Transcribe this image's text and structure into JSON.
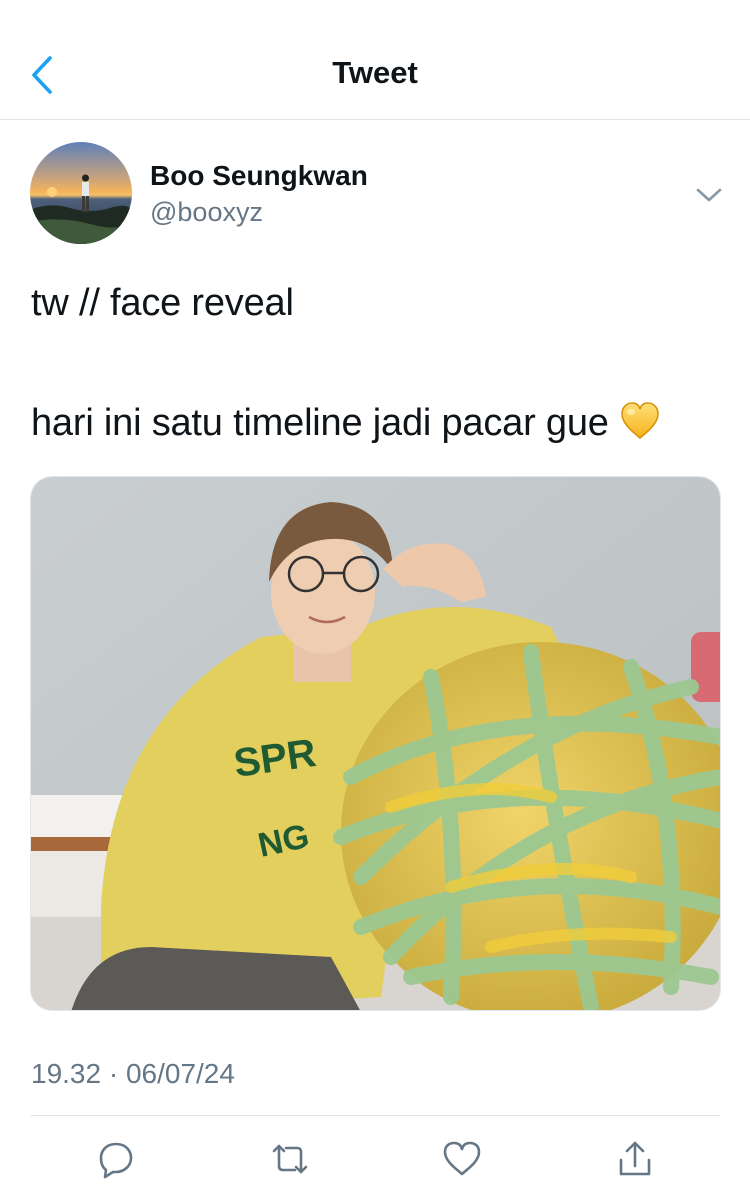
{
  "header": {
    "title": "Tweet",
    "back_icon": "chevron-left-icon"
  },
  "author": {
    "name": "Boo Seungkwan",
    "handle": "@booxyz"
  },
  "tweet": {
    "line1": "tw // face reveal",
    "line2": "hari ini satu timeline jadi pacar gue",
    "emoji": "yellow-heart-icon",
    "timestamp": "19.32 · 06/07/24"
  },
  "actions": [
    {
      "icon": "reply-icon"
    },
    {
      "icon": "retweet-icon"
    },
    {
      "icon": "like-icon"
    },
    {
      "icon": "share-icon"
    }
  ],
  "colors": {
    "accent": "#1da1f2",
    "text": "#0f1419",
    "secondary": "#657786",
    "border": "#e1e8ed",
    "emoji_heart": "#fcc21b"
  }
}
